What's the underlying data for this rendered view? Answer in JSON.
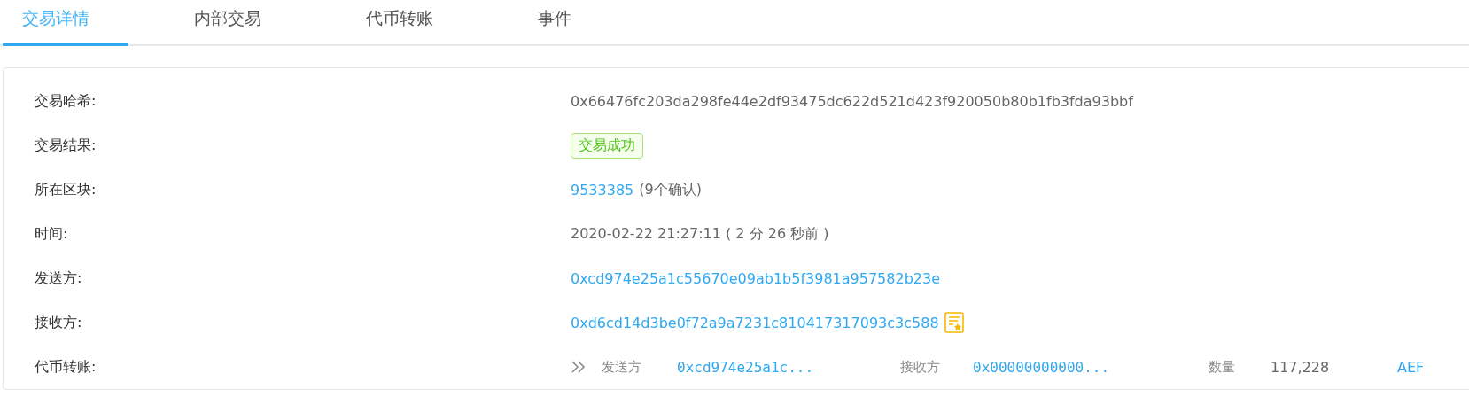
{
  "tabs": [
    {
      "label": "交易详情",
      "selected": true
    },
    {
      "label": "内部交易",
      "selected": false
    },
    {
      "label": "代币转账",
      "selected": false
    },
    {
      "label": "事件",
      "selected": false
    }
  ],
  "details": [
    {
      "kind": "text",
      "label": "交易哈希:",
      "value": "0x66476fc203da298fe44e2df93475dc622d521d423f920050b80b1fb3fda93bbf"
    },
    {
      "kind": "badge",
      "label": "交易结果:",
      "value": "交易成功"
    },
    {
      "kind": "block",
      "label": "所在区块:",
      "value": "9533385",
      "note": "(9个确认)"
    },
    {
      "kind": "text",
      "label": "时间:",
      "value": "2020-02-22 21:27:11 ( 2 分 26 秒前 )"
    },
    {
      "kind": "link",
      "label": "发送方:",
      "value": "0xcd974e25a1c55670e09ab1b5f3981a957582b23e"
    },
    {
      "kind": "contract",
      "label": "接收方:",
      "value": "0xd6cd14d3be0f72a9a7231c810417317093c3c588"
    },
    {
      "kind": "transfer",
      "label": "代币转账:",
      "from_label": "发送方",
      "from": "0xcd974e25a1c...",
      "to_label": "接收方",
      "to": "0x00000000000...",
      "amount_label": "数量",
      "amount": "117,228",
      "token": "AEF"
    }
  ]
}
